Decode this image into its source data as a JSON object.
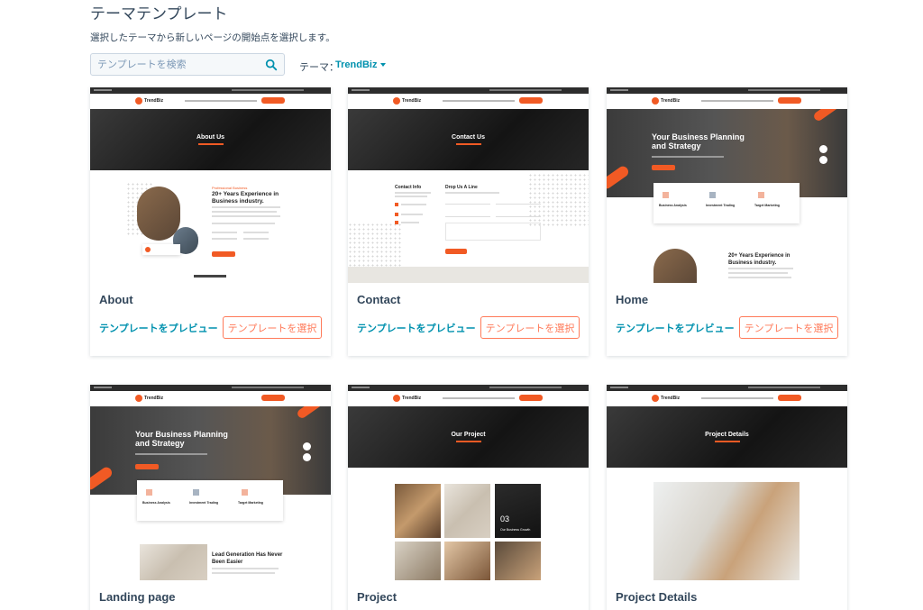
{
  "header": {
    "title": "テーマテンプレート",
    "subtitle": "選択したテーマから新しいページの開始点を選択します。"
  },
  "search": {
    "placeholder": "テンプレートを検索",
    "icon": "search-icon"
  },
  "theme": {
    "label": "テーマ：",
    "value": "TrendBiz"
  },
  "actions": {
    "preview": "テンプレートをプレビュー",
    "select": "テンプレートを選択"
  },
  "colors": {
    "accent": "#ff7a59",
    "link": "#0091ae",
    "brand": "#f15a24"
  },
  "templates": [
    {
      "name": "About",
      "thumb": {
        "brand": "TrendBiz",
        "hero_title": "About Us",
        "label": "Professional Business",
        "heading": "20+ Years Experience in Business industry.",
        "phone": "1 (800) 456-7890",
        "button": "Read More"
      }
    },
    {
      "name": "Contact",
      "thumb": {
        "brand": "TrendBiz",
        "hero_title": "Contact Us",
        "info_title": "Contact Info",
        "form_title": "Drop Us A Line",
        "button": "Send Message"
      }
    },
    {
      "name": "Home",
      "thumb": {
        "brand": "TrendBiz",
        "hero_title": "Your Business Planning and Strategy",
        "features": [
          "Business Analysis",
          "Investment Trading",
          "Target Marketing"
        ],
        "heading": "20+ Years Experience in Business industry."
      }
    },
    {
      "name": "Landing page",
      "thumb": {
        "brand": "TrendBiz",
        "hero_title": "Your Business Planning and Strategy",
        "features": [
          "Business Analysis",
          "Investment Trading",
          "Target Marketing"
        ],
        "heading": "Lead Generation Has Never Been Easier"
      }
    },
    {
      "name": "Project",
      "thumb": {
        "brand": "TrendBiz",
        "hero_title": "Our Project",
        "tile_number": "03",
        "tile_caption": "Our Business Growth"
      }
    },
    {
      "name": "Project Details",
      "thumb": {
        "brand": "TrendBiz",
        "hero_title": "Project Details"
      }
    }
  ]
}
